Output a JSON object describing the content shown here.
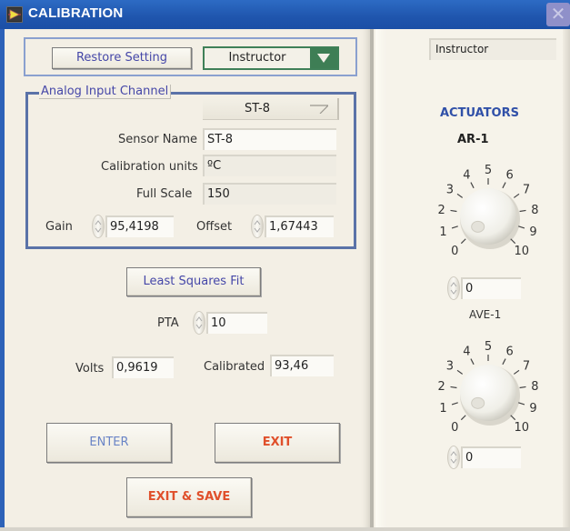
{
  "window": {
    "title": "CALIBRATION",
    "app_icon": "labview-run-icon",
    "close_icon": "close-icon"
  },
  "top_controls": {
    "restore_button": "Restore Setting",
    "user_select": {
      "selected": "Instructor"
    }
  },
  "analog_input": {
    "group_label": "Analog Input Channel",
    "channel_select": {
      "selected": "ST-8"
    },
    "sensor_name": {
      "label": "Sensor Name",
      "value": "ST-8"
    },
    "calibration_units": {
      "label": "Calibration units",
      "value": "ºC"
    },
    "full_scale": {
      "label": "Full Scale",
      "value": "150"
    },
    "gain": {
      "label": "Gain",
      "value": "95,4198"
    },
    "offset": {
      "label": "Offset",
      "value": "1,67443"
    }
  },
  "fit": {
    "least_squares_button": "Least Squares  Fit",
    "pta": {
      "label": "PTA",
      "value": "10"
    },
    "volts": {
      "label": "Volts",
      "value": "0,9619"
    },
    "calibrated": {
      "label": "Calibrated",
      "value": "93,46"
    }
  },
  "actions": {
    "enter": "ENTER",
    "exit": "EXIT",
    "exit_save": "EXIT & SAVE"
  },
  "right_panel": {
    "role_display": "Instructor",
    "actuators_title": "ACTUATORS",
    "actuators": [
      {
        "name": "AR-1",
        "value": "0",
        "knob_value": 0,
        "scale": [
          "0",
          "1",
          "2",
          "3",
          "4",
          "5",
          "6",
          "7",
          "8",
          "9",
          "10"
        ]
      },
      {
        "name": "AVE-1",
        "value": "0",
        "knob_value": 0,
        "scale": [
          "0",
          "1",
          "2",
          "3",
          "4",
          "5",
          "6",
          "7",
          "8",
          "9",
          "10"
        ]
      }
    ]
  },
  "colors": {
    "titlebar": "#1f55ad",
    "link_text": "#4547a8",
    "exit_text": "#e0502b",
    "enter_text": "#6a84c6",
    "dropdown_green": "#3e7e55",
    "group_border": "#5a72a8",
    "actuators_title": "#3050a8"
  }
}
